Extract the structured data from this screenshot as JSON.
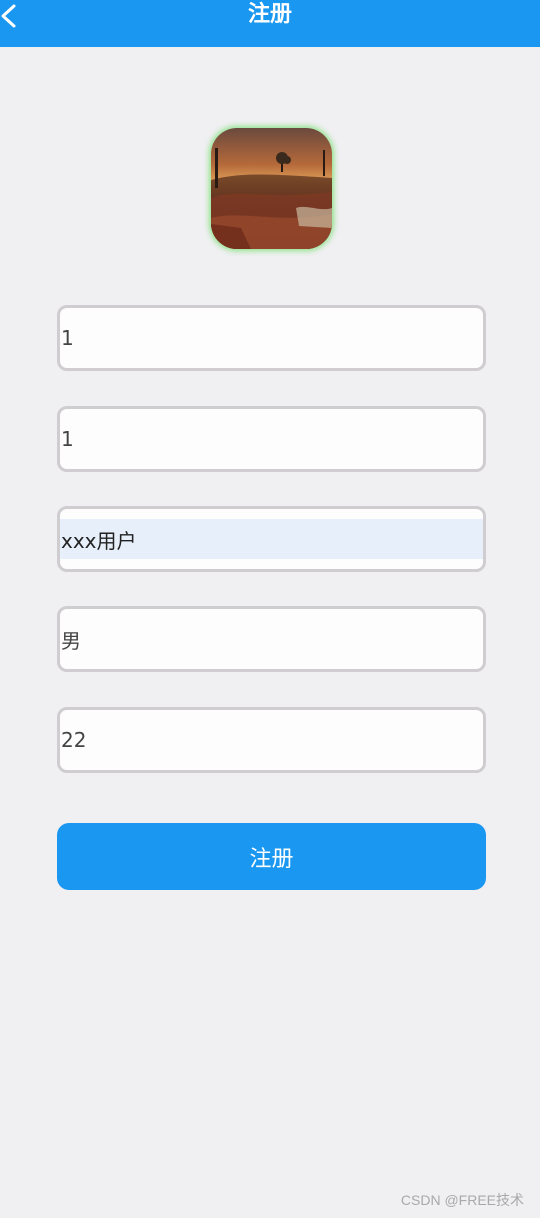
{
  "header": {
    "title": "注册",
    "back_icon": "chevron-left-icon",
    "background_color": "#1a97f0"
  },
  "avatar": {
    "description_icon": "landscape-photo"
  },
  "form": {
    "fields": [
      {
        "value": "1"
      },
      {
        "value": "1"
      },
      {
        "value": "xxx用户"
      },
      {
        "value": "男"
      },
      {
        "value": "22"
      }
    ],
    "submit_label": "注册"
  },
  "watermark": {
    "text": "CSDN @FREE技术"
  },
  "colors": {
    "accent": "#1a97f0",
    "background": "#f0eff2",
    "field_border": "#cfcdd0",
    "autofill_highlight": "#e7effb"
  }
}
